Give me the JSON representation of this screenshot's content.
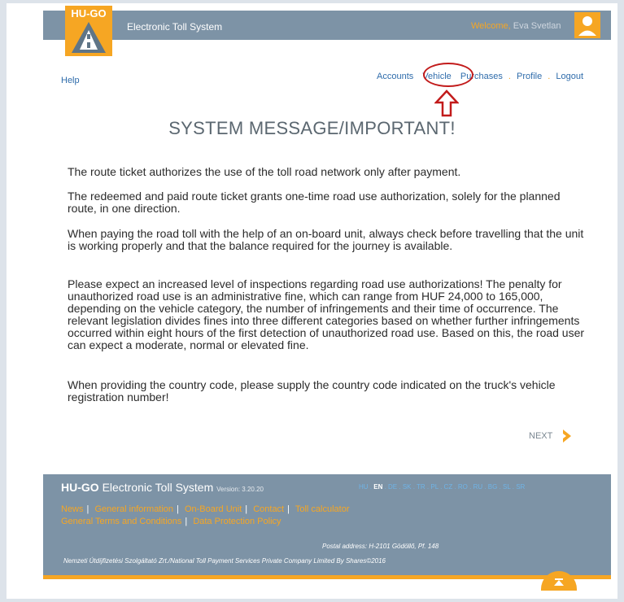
{
  "header": {
    "logo_text": "HU-GO",
    "app_title": "Electronic Toll System",
    "welcome_label": "Welcome,",
    "welcome_name": "Eva Svetlan"
  },
  "nav": {
    "help": "Help",
    "items": [
      "Accounts",
      "Vehicle",
      "Purchases",
      "Profile",
      "Logout"
    ],
    "separator": "."
  },
  "content": {
    "title": "SYSTEM MESSAGE/IMPORTANT!",
    "paragraphs": [
      "The route ticket authorizes the use of the toll road network only after payment.",
      "The redeemed and paid route ticket grants one-time road use authorization, solely for the planned route, in one direction.",
      "When paying the road toll with the help of an on-board unit, always check before travelling that the unit is working properly and that the balance required for the journey is available.",
      "Please expect an increased level of inspections regarding road use authorizations! The penalty for unauthorized road use is an administrative fine, which can range from HUF 24,000 to 165,000, depending on the vehicle category, the number of infringements and their time of occurrence. The relevant legislation divides fines into three different categories based on whether further infringements occurred within eight hours of the first detection of unauthorized road use. Based on this, the road user can expect a moderate, normal or elevated fine.",
      "When providing the country code, please supply the country code indicated on the truck's vehicle registration number!"
    ],
    "next_label": "NEXT"
  },
  "footer": {
    "brand": "HU-GO",
    "title": "Electronic Toll System",
    "version": "Version: 3.20.20",
    "languages": [
      "HU",
      "EN",
      "DE",
      "SK",
      "TR",
      "PL",
      "CZ",
      "RO",
      "RU",
      "BG",
      "SL",
      "SR"
    ],
    "selected_language": "EN",
    "links": [
      "News",
      "General information",
      "On-Board Unit",
      "Contact",
      "Toll calculator",
      "General Terms and Conditions",
      "Data Protection Policy"
    ],
    "postal": "Postal address: H-2101 Gödöllő, Pf. 148",
    "company": "Nemzeti Útdíjfizetési Szolgáltató Zrt./National Toll Payment Services Private Company Limited By Shares©2016"
  },
  "colors": {
    "header_bg": "#7d93a6",
    "accent": "#f6a623",
    "link": "#2f6cab",
    "highlight": "#c21b1b"
  },
  "icons": {
    "logo": "road-logo-icon",
    "user": "user-icon",
    "annotation": "up-arrow-icon",
    "next": "chevron-right-icon",
    "scroll_top": "scroll-top-icon"
  }
}
